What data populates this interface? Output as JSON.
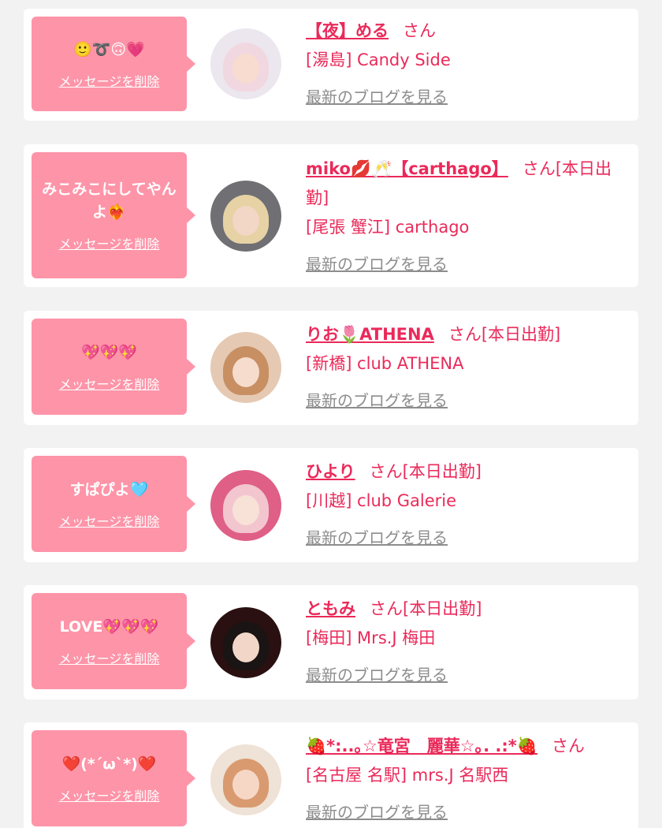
{
  "labels": {
    "delete": "メッセージを削除",
    "blog": "最新のブログを見る",
    "san": "さん"
  },
  "colors": {
    "accent": "#ea2a5a",
    "bubble": "#fe94a8",
    "link_gray": "#8d8d8d",
    "background": "#f2f2f2",
    "card": "#ffffff"
  },
  "cards": [
    {
      "message": "🙂➰🙃💗",
      "name": "【夜】める",
      "status": "",
      "shop": "[湯島] Candy Side",
      "avatar": {
        "hair": "#f1d8e0",
        "bg": "#ece6ef",
        "face": "#f7dccf"
      }
    },
    {
      "message": "みこみこにしてやんよ❤️‍🔥",
      "name": "miko💋🥂【carthago】",
      "status": "[本日出勤]",
      "shop": "[尾張 蟹江] carthago",
      "avatar": {
        "hair": "#e6d2a4",
        "bg": "#6f6f74",
        "face": "#f2d6c6"
      }
    },
    {
      "message": "💖💖💖",
      "name": "りお🌷ATHENA",
      "status": "[本日出勤]",
      "shop": "[新橋] club ATHENA",
      "avatar": {
        "hair": "#c88f62",
        "bg": "#e5c9b3",
        "face": "#f6dccd"
      }
    },
    {
      "message": "すぱぴよ🩵",
      "name": "ひより",
      "status": "[本日出勤]",
      "shop": "[川越] club Galerie",
      "avatar": {
        "hair": "#f3c6cf",
        "bg": "#df5f86",
        "face": "#f8e2d8"
      }
    },
    {
      "message": "LOVE💖💖💖",
      "name": "ともみ",
      "status": "[本日出勤]",
      "shop": "[梅田] Mrs.J 梅田",
      "avatar": {
        "hair": "#1a1414",
        "bg": "#2a1010",
        "face": "#f2d7c8"
      }
    },
    {
      "message": "❤️(*´ω`*)❤️",
      "name": "🍓*:..｡☆竜宮　麗華☆｡. .:*🍓",
      "status": "",
      "shop": "[名古屋 名駅] mrs.J 名駅西",
      "avatar": {
        "hair": "#d99a70",
        "bg": "#efe2d6",
        "face": "#f6d7c6"
      }
    }
  ]
}
